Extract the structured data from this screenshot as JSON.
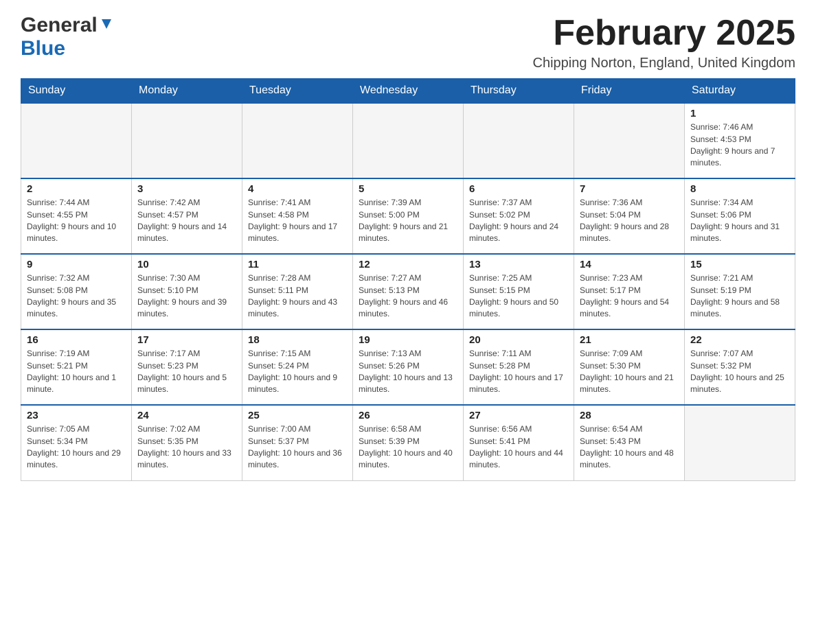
{
  "header": {
    "logo_general": "General",
    "logo_blue": "Blue",
    "month_title": "February 2025",
    "location": "Chipping Norton, England, United Kingdom"
  },
  "weekdays": [
    "Sunday",
    "Monday",
    "Tuesday",
    "Wednesday",
    "Thursday",
    "Friday",
    "Saturday"
  ],
  "weeks": [
    [
      {
        "day": "",
        "info": ""
      },
      {
        "day": "",
        "info": ""
      },
      {
        "day": "",
        "info": ""
      },
      {
        "day": "",
        "info": ""
      },
      {
        "day": "",
        "info": ""
      },
      {
        "day": "",
        "info": ""
      },
      {
        "day": "1",
        "info": "Sunrise: 7:46 AM\nSunset: 4:53 PM\nDaylight: 9 hours and 7 minutes."
      }
    ],
    [
      {
        "day": "2",
        "info": "Sunrise: 7:44 AM\nSunset: 4:55 PM\nDaylight: 9 hours and 10 minutes."
      },
      {
        "day": "3",
        "info": "Sunrise: 7:42 AM\nSunset: 4:57 PM\nDaylight: 9 hours and 14 minutes."
      },
      {
        "day": "4",
        "info": "Sunrise: 7:41 AM\nSunset: 4:58 PM\nDaylight: 9 hours and 17 minutes."
      },
      {
        "day": "5",
        "info": "Sunrise: 7:39 AM\nSunset: 5:00 PM\nDaylight: 9 hours and 21 minutes."
      },
      {
        "day": "6",
        "info": "Sunrise: 7:37 AM\nSunset: 5:02 PM\nDaylight: 9 hours and 24 minutes."
      },
      {
        "day": "7",
        "info": "Sunrise: 7:36 AM\nSunset: 5:04 PM\nDaylight: 9 hours and 28 minutes."
      },
      {
        "day": "8",
        "info": "Sunrise: 7:34 AM\nSunset: 5:06 PM\nDaylight: 9 hours and 31 minutes."
      }
    ],
    [
      {
        "day": "9",
        "info": "Sunrise: 7:32 AM\nSunset: 5:08 PM\nDaylight: 9 hours and 35 minutes."
      },
      {
        "day": "10",
        "info": "Sunrise: 7:30 AM\nSunset: 5:10 PM\nDaylight: 9 hours and 39 minutes."
      },
      {
        "day": "11",
        "info": "Sunrise: 7:28 AM\nSunset: 5:11 PM\nDaylight: 9 hours and 43 minutes."
      },
      {
        "day": "12",
        "info": "Sunrise: 7:27 AM\nSunset: 5:13 PM\nDaylight: 9 hours and 46 minutes."
      },
      {
        "day": "13",
        "info": "Sunrise: 7:25 AM\nSunset: 5:15 PM\nDaylight: 9 hours and 50 minutes."
      },
      {
        "day": "14",
        "info": "Sunrise: 7:23 AM\nSunset: 5:17 PM\nDaylight: 9 hours and 54 minutes."
      },
      {
        "day": "15",
        "info": "Sunrise: 7:21 AM\nSunset: 5:19 PM\nDaylight: 9 hours and 58 minutes."
      }
    ],
    [
      {
        "day": "16",
        "info": "Sunrise: 7:19 AM\nSunset: 5:21 PM\nDaylight: 10 hours and 1 minute."
      },
      {
        "day": "17",
        "info": "Sunrise: 7:17 AM\nSunset: 5:23 PM\nDaylight: 10 hours and 5 minutes."
      },
      {
        "day": "18",
        "info": "Sunrise: 7:15 AM\nSunset: 5:24 PM\nDaylight: 10 hours and 9 minutes."
      },
      {
        "day": "19",
        "info": "Sunrise: 7:13 AM\nSunset: 5:26 PM\nDaylight: 10 hours and 13 minutes."
      },
      {
        "day": "20",
        "info": "Sunrise: 7:11 AM\nSunset: 5:28 PM\nDaylight: 10 hours and 17 minutes."
      },
      {
        "day": "21",
        "info": "Sunrise: 7:09 AM\nSunset: 5:30 PM\nDaylight: 10 hours and 21 minutes."
      },
      {
        "day": "22",
        "info": "Sunrise: 7:07 AM\nSunset: 5:32 PM\nDaylight: 10 hours and 25 minutes."
      }
    ],
    [
      {
        "day": "23",
        "info": "Sunrise: 7:05 AM\nSunset: 5:34 PM\nDaylight: 10 hours and 29 minutes."
      },
      {
        "day": "24",
        "info": "Sunrise: 7:02 AM\nSunset: 5:35 PM\nDaylight: 10 hours and 33 minutes."
      },
      {
        "day": "25",
        "info": "Sunrise: 7:00 AM\nSunset: 5:37 PM\nDaylight: 10 hours and 36 minutes."
      },
      {
        "day": "26",
        "info": "Sunrise: 6:58 AM\nSunset: 5:39 PM\nDaylight: 10 hours and 40 minutes."
      },
      {
        "day": "27",
        "info": "Sunrise: 6:56 AM\nSunset: 5:41 PM\nDaylight: 10 hours and 44 minutes."
      },
      {
        "day": "28",
        "info": "Sunrise: 6:54 AM\nSunset: 5:43 PM\nDaylight: 10 hours and 48 minutes."
      },
      {
        "day": "",
        "info": ""
      }
    ]
  ]
}
